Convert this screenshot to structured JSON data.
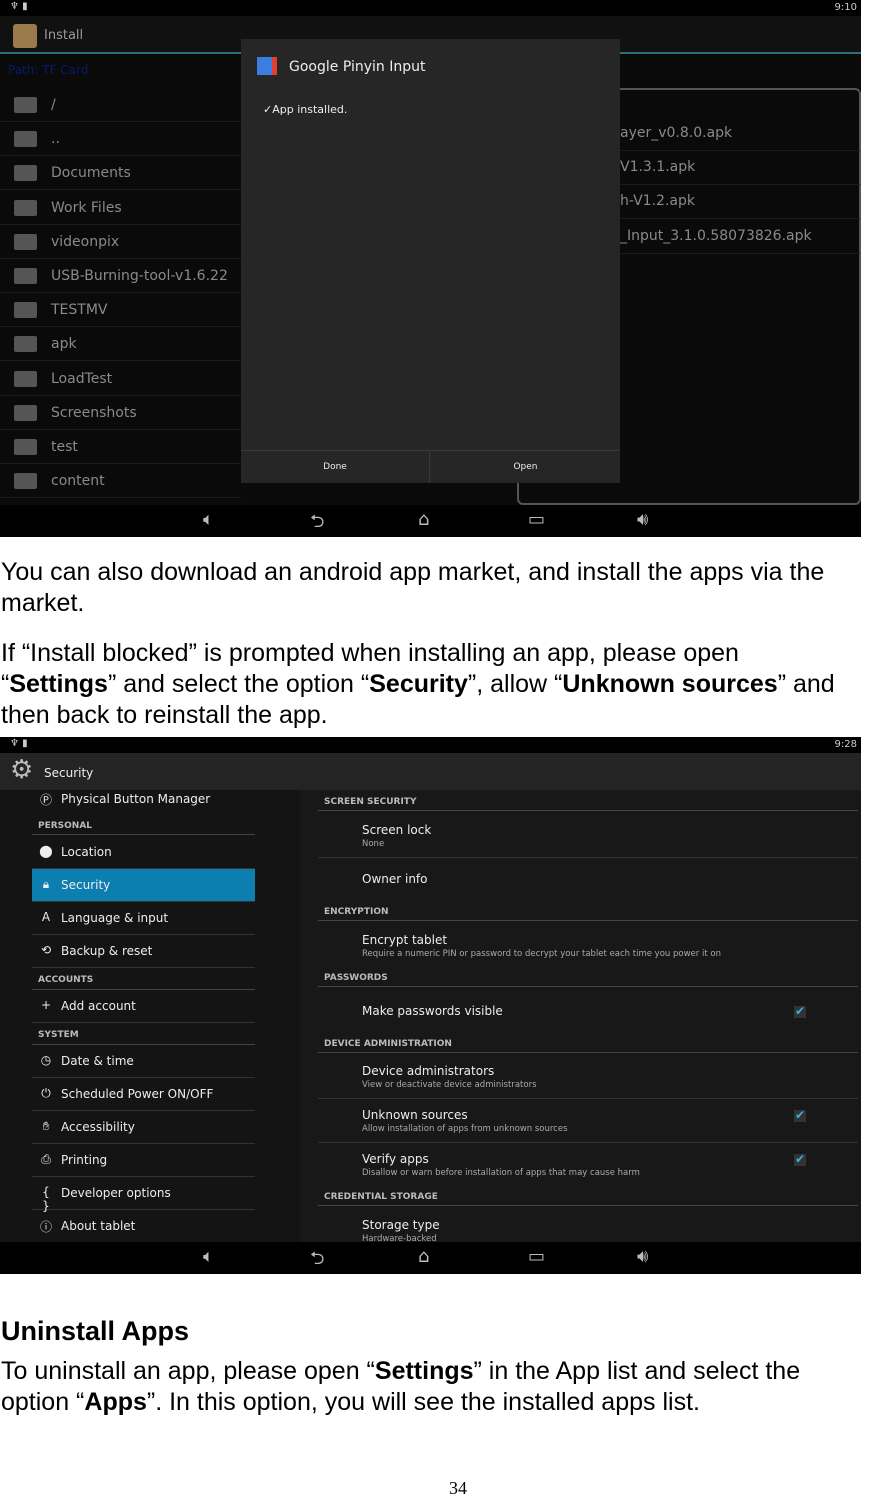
{
  "shot1": {
    "time": "9:10",
    "app_title": "Install",
    "path_label": "Path:",
    "path_value": "TF Card",
    "files": [
      "/",
      "..",
      "Documents",
      "Work Files",
      "videonpix",
      "USB-Burning-tool-v1.6.22",
      "TESTMV",
      "apk",
      "LoadTest",
      "Screenshots",
      "test",
      "content"
    ],
    "right_files": [
      "ayer_v0.8.0.apk",
      "V1.3.1.apk",
      "h-V1.2.apk",
      "_Input_3.1.0.58073826.apk"
    ],
    "dialog": {
      "title": "Google Pinyin Input",
      "message": "App installed.",
      "done": "Done",
      "open": "Open"
    }
  },
  "text": {
    "p1a": "You can also download an android app market, and install the apps via the",
    "p1b": "market.",
    "p2a": "If “Install blocked” is prompted when installing an app, please open",
    "p2b_1": "“",
    "p2b_settings": "Settings",
    "p2b_2": "” and select the option “",
    "p2b_security": "Security",
    "p2b_3": "”, allow “",
    "p2b_unknown": "Unknown sources",
    "p2b_4": "” and",
    "p2c": "then back to reinstall the app.",
    "heading": "Uninstall Apps",
    "p3a_1": "To uninstall an app, please open “",
    "p3a_settings": "Settings",
    "p3a_2": "” in the App list and select the",
    "p3b_1": "option “",
    "p3b_apps": "Apps",
    "p3b_2": "”. In this option, you will see the installed apps list.",
    "page_number": "34"
  },
  "shot2": {
    "time": "9:28",
    "title": "Security",
    "top_item": "Physical Button Manager",
    "sections": {
      "personal": "PERSONAL",
      "accounts": "ACCOUNTS",
      "system": "SYSTEM"
    },
    "personal": [
      "Location",
      "Security",
      "Language & input",
      "Backup & reset"
    ],
    "accounts": [
      "Add account"
    ],
    "system": [
      "Date & time",
      "Scheduled Power ON/OFF",
      "Accessibility",
      "Printing",
      "Developer options",
      "About tablet"
    ],
    "selected": "Security",
    "accent": "#0c7eb0",
    "right": {
      "screen_security": "SCREEN SECURITY",
      "screen_lock": "Screen lock",
      "screen_lock_sub": "None",
      "owner_info": "Owner info",
      "encryption": "ENCRYPTION",
      "encrypt": "Encrypt tablet",
      "encrypt_sub": "Require a numeric PIN or password to decrypt your tablet each time you power it on",
      "passwords": "PASSWORDS",
      "make_visible": "Make passwords visible",
      "device_admin": "DEVICE ADMINISTRATION",
      "admins": "Device administrators",
      "admins_sub": "View or deactivate device administrators",
      "unknown": "Unknown sources",
      "unknown_sub": "Allow installation of apps from unknown sources",
      "verify": "Verify apps",
      "verify_sub": "Disallow or warn before installation of apps that may cause harm",
      "credential": "CREDENTIAL STORAGE",
      "storage": "Storage type",
      "storage_sub": "Hardware-backed",
      "checked": {
        "make_visible": true,
        "unknown": true,
        "verify": true
      }
    }
  }
}
